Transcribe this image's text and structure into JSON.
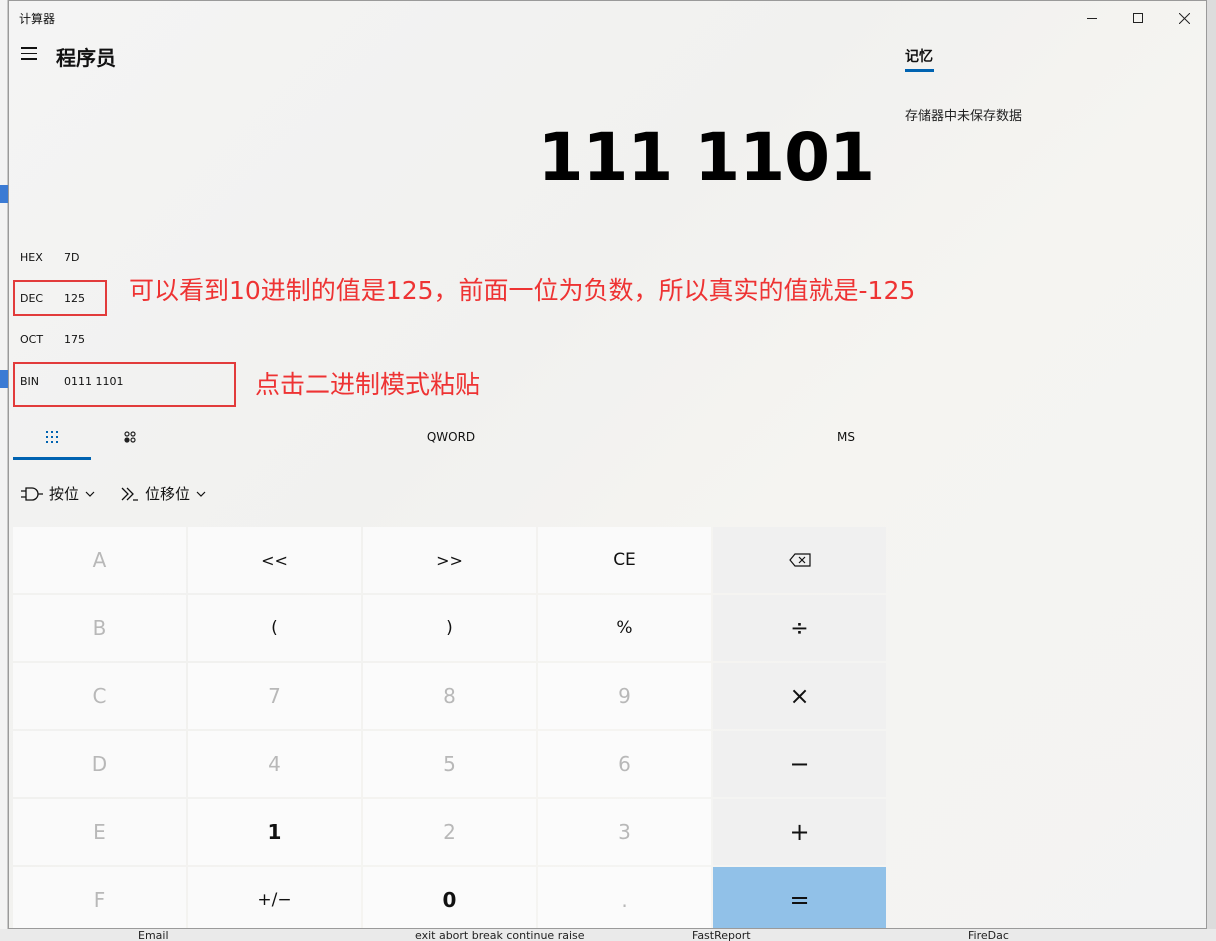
{
  "window": {
    "title": "计算器"
  },
  "header": {
    "mode_title": "程序员",
    "menu_icon": "hamburger-icon"
  },
  "display": {
    "value": "111 1101"
  },
  "memory": {
    "tab_label": "记忆",
    "empty_message": "存储器中未保存数据"
  },
  "radix": [
    {
      "label": "HEX",
      "value": "7D"
    },
    {
      "label": "DEC",
      "value": "125"
    },
    {
      "label": "OCT",
      "value": "175"
    },
    {
      "label": "BIN",
      "value": "0111 1101"
    }
  ],
  "annotations": {
    "dec_note": "可以看到10进制的值是125，前面一位为负数，所以真实的值就是-125",
    "bin_note": "点击二进制模式粘贴",
    "color": "#e23b3b"
  },
  "tabs": {
    "word_size": "QWORD",
    "ms": "MS"
  },
  "tools": {
    "bitwise": "按位",
    "bitshift": "位移位"
  },
  "keys": [
    [
      "A",
      "<<",
      ">>",
      "CE",
      "⌫"
    ],
    [
      "B",
      "(",
      ")",
      "%",
      "÷"
    ],
    [
      "C",
      "7",
      "8",
      "9",
      "×"
    ],
    [
      "D",
      "4",
      "5",
      "6",
      "−"
    ],
    [
      "E",
      "1",
      "2",
      "3",
      "+"
    ],
    [
      "F",
      "+/−",
      "0",
      ".",
      "="
    ]
  ],
  "background_app": {
    "bottom_items": [
      "Email",
      "exit abort break continue raise",
      "FastReport",
      "FireDac"
    ]
  },
  "colors": {
    "accent": "#0063b1",
    "equals": "#91c1e8"
  }
}
